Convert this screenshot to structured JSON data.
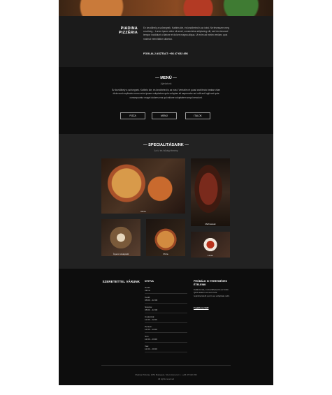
{
  "about": {
    "title": "PIADINA PIZZÉRIA",
    "subtitle": "Rólunk",
    "text": "Ez kezdőhely a szövegnek. Kattints ide, és kezdheted is az írást. Ne tévesszen meg a szöveg... Lorem ipsum dolor sit amet, consectetur adipiscing elit, sed do eiusmod tempor incididunt ut labore et dolore magna aliqua. Ut enim ad minim veniam, quis nostrud exercitation ullamco.",
    "phone": "FOGLALJ ASZTALT: +36 47 632 456"
  },
  "menu": {
    "title": "— MENÜ —",
    "subtitle": "Ajánlatunk",
    "text": "Ez kezdőhely a szövegnek. Kattints ide, és kezdheted is az írást. Verbatim et quasi architecto beatae vitae dicta sunt explicabo nemo enim ipsam voluptatem quia voluptas sit aspernatur aut odit aut fugit sed quia consequuntur magni dolores eos qui ratione voluptatem sequi nesciunt.",
    "buttons": [
      "PIZZA",
      "MENÜ",
      "ITALOK"
    ]
  },
  "specials": {
    "title": "— SPECIALITÁSAINK —",
    "subtitle": "Az íz és hűség élmény",
    "captions": [
      "Pizza",
      "Marhasteak",
      "Ínyenc szelepsüti",
      "Pizza",
      "Leves"
    ]
  },
  "contact": {
    "title": "SZERETETTEL VÁRUNK",
    "hours_title": "NYITVA",
    "hours": [
      {
        "day": "Hétfő:",
        "time": "zárva"
      },
      {
        "day": "Kedd:",
        "time": "08:00 - 22:00"
      },
      {
        "day": "Szerda:",
        "time": "08:00 - 22:00"
      },
      {
        "day": "Csütörtök:",
        "time": "11:00 - 22:00"
      },
      {
        "day": "Péntek:",
        "time": "11:00 - 23:00"
      },
      {
        "day": "Szo:",
        "time": "11:00 - 23:00"
      },
      {
        "day": "Vas:",
        "time": "11:00 - 20:00"
      }
    ],
    "job_title": "PRÓBÁLD KI TEHEHSÉGES ÉTELEINK",
    "job_text": "Kattints ide, és kezdheted is az írást. Quis autem vel eum iure reprehenderit qui in ea voluptate velit.",
    "job_link": "Foglalj asztalt!"
  },
  "footer": {
    "line1": "Piadina Pizzéria, 1051 Budapest, Szent Anna tér 1. | +36 47 632 456",
    "line2": "All rights reserved"
  }
}
